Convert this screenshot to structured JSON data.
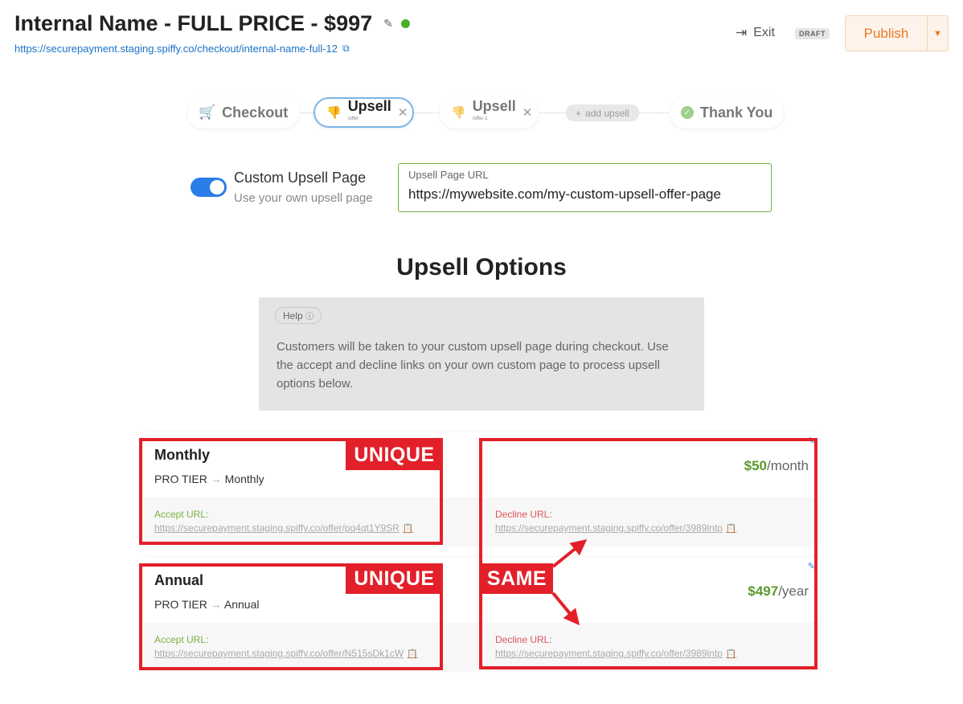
{
  "header": {
    "title": "Internal Name - FULL PRICE - $997",
    "url": "https://securepayment.staging.spiffy.co/checkout/internal-name-full-12",
    "exit_label": "Exit",
    "draft_badge": "DRAFT",
    "publish_label": "Publish",
    "status_color": "#4caf28"
  },
  "steps": {
    "checkout": "Checkout",
    "upsell_active": "Upsell",
    "upsell_active_sub": "/offer",
    "upsell_2": "Upsell",
    "upsell_2_sub": "/offer-1",
    "add_upsell": "add upsell",
    "thank_you": "Thank You"
  },
  "custom_page": {
    "title": "Custom Upsell Page",
    "subtitle": "Use your own upsell page",
    "enabled": true,
    "url_label": "Upsell Page URL",
    "url_value": "https://mywebsite.com/my-custom-upsell-offer-page"
  },
  "upsell_options": {
    "title": "Upsell Options",
    "help_chip": "Help",
    "help_text": "Customers will be taken to your custom upsell page during checkout. Use the accept and decline links on your own custom page to process upsell options below."
  },
  "options": [
    {
      "name": "Monthly",
      "tier": "PRO TIER",
      "plan": "Monthly",
      "price": "$50",
      "period": "/month",
      "accept_label": "Accept URL:",
      "accept_url": "https://securepayment.staging.spiffy.co/offer/pq4qt1Y9SR",
      "decline_label": "Decline URL:",
      "decline_url": "https://securepayment.staging.spiffy.co/offer/3989lntp"
    },
    {
      "name": "Annual",
      "tier": "PRO TIER",
      "plan": "Annual",
      "price": "$497",
      "period": "/year",
      "accept_label": "Accept URL:",
      "accept_url": "https://securepayment.staging.spiffy.co/offer/N515sDk1cW",
      "decline_label": "Decline URL:",
      "decline_url": "https://securepayment.staging.spiffy.co/offer/3989lntp"
    }
  ],
  "annotations": {
    "unique_1": "UNIQUE",
    "unique_2": "UNIQUE",
    "same": "SAME",
    "color": "#e3202a"
  }
}
